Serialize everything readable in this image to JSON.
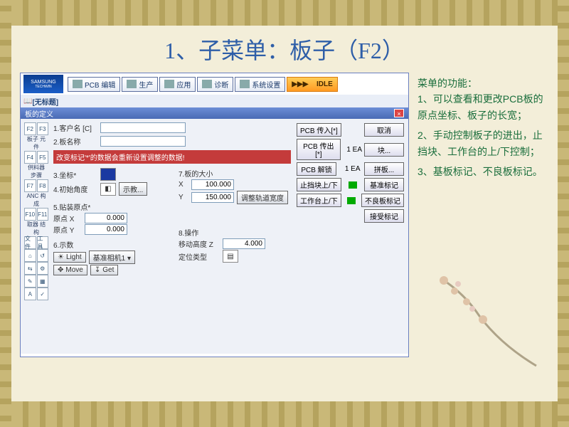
{
  "slide": {
    "title": "1、子菜单：板子（F2）"
  },
  "app": {
    "brand": "SAMSUNG",
    "brand2": "TECHWIN",
    "tabs": [
      "PCB 编辑",
      "生产",
      "应用",
      "诊断",
      "系统设置"
    ],
    "idle_arrows": "▶▶▶",
    "idle": "IDLE",
    "subtitle": "[无标题]"
  },
  "left_tool_rows": [
    {
      "icons": [
        "F2",
        "F3"
      ],
      "label": "板子 元件"
    },
    {
      "icons": [
        "F4",
        "F5"
      ],
      "label": "供料器 步骤"
    },
    {
      "icons": [
        "F7",
        "F8"
      ],
      "label": "ANC 构成"
    },
    {
      "icons": [
        "F10",
        "F11"
      ],
      "label": "取器 结构"
    },
    {
      "icons": [
        "文件",
        "工具"
      ],
      "label": ""
    },
    {
      "icons": [
        "⌂",
        "↺"
      ],
      "label": ""
    },
    {
      "icons": [
        "⇆",
        "⚙"
      ],
      "label": ""
    },
    {
      "icons": [
        "✎",
        "▦"
      ],
      "label": ""
    },
    {
      "icons": [
        "A",
        "✓"
      ],
      "label": ""
    }
  ],
  "dialog": {
    "title": "板的定义",
    "close": "×",
    "customer_lbl": "1.客户名  [C]",
    "boardname_lbl": "2.板名称",
    "redband": "改变标记'*'的数据会重新设置调整的数据!",
    "coord_lbl": "3.坐标*",
    "initangle_lbl": "4.初始角度",
    "initangle_btn": "示教...",
    "size_lbl": "7.板的大小",
    "size_x": "X",
    "size_x_val": "100.000",
    "size_y": "Y",
    "size_y_val": "150.000",
    "rail_btn": "调整轨道宽度",
    "origin_lbl": "5.贴装原点*",
    "origin_x": "原点 X",
    "origin_x_val": "0.000",
    "origin_y": "原点 Y",
    "origin_y_val": "0.000",
    "teach_lbl": "6.示数",
    "light_btn": "Light",
    "light_sel": "基准相机1 ▾",
    "move_btn": "Move",
    "get_btn": "Get",
    "op_lbl": "8.操作",
    "movez_lbl": "移动高度 Z",
    "movez_val": "4.000",
    "postype_lbl": "定位类型"
  },
  "right": {
    "pcb_in": "PCB 传入[*]",
    "pcb_out": "PCB 传出[*]",
    "pcb_unlock": "PCB 解锁",
    "stopper": "止挡块上/下",
    "worktable": "工作台上/下",
    "cancel": "取消",
    "ea1": "1 EA",
    "blk": "块...",
    "ea2": "1 EA",
    "pinban": "拼板...",
    "fiducial": "基准标记",
    "badmark": "不良板标记",
    "accept": "接受标记"
  },
  "notes": {
    "header": "菜单的功能：",
    "items": [
      "1、可以查看和更改PCB板的原点坐标、板子的长宽；",
      "2、手动控制板子的进出，止挡块、工作台的上/下控制；",
      "3、基板标记、不良板标记。"
    ]
  }
}
